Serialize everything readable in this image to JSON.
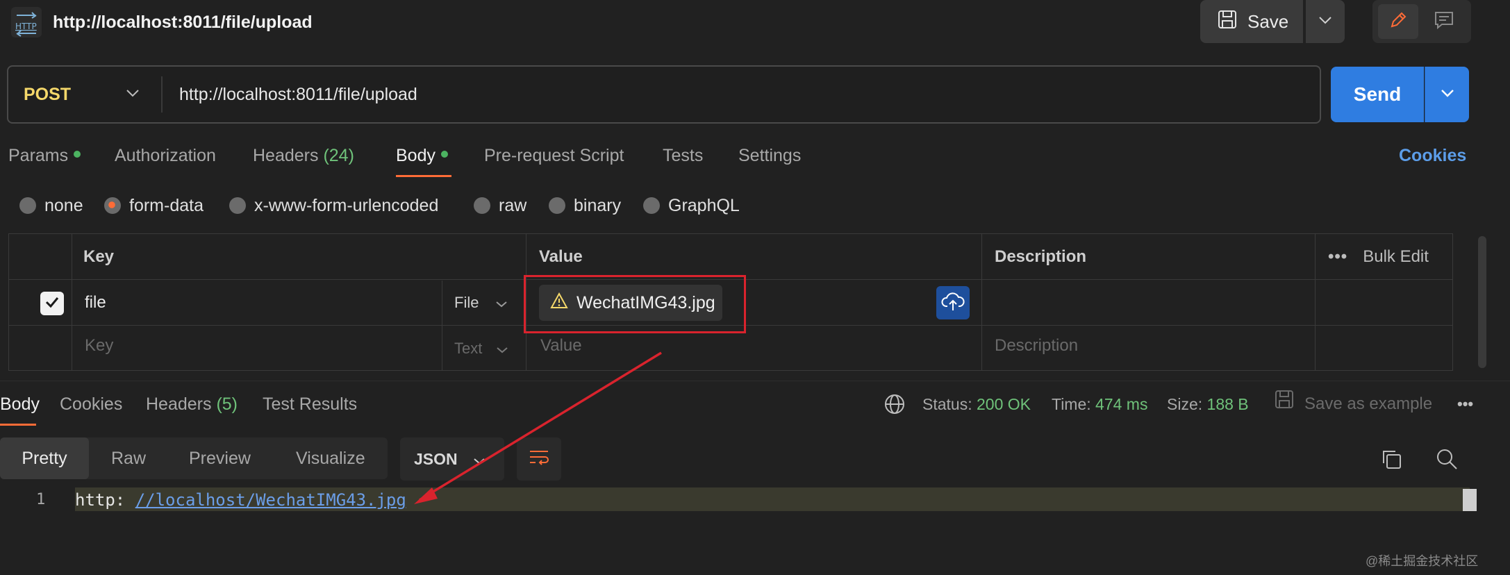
{
  "header": {
    "icon": "http-icon",
    "title": "http://localhost:8011/file/upload",
    "save_label": "Save"
  },
  "request": {
    "method": "POST",
    "url": "http://localhost:8011/file/upload",
    "send_label": "Send"
  },
  "request_tabs": [
    {
      "label": "Params",
      "dot": true
    },
    {
      "label": "Authorization"
    },
    {
      "label": "Headers",
      "count": "(24)"
    },
    {
      "label": "Body",
      "dot": true,
      "active": true
    },
    {
      "label": "Pre-request Script"
    },
    {
      "label": "Tests"
    },
    {
      "label": "Settings"
    }
  ],
  "cookies_link": "Cookies",
  "body_modes": [
    {
      "label": "none"
    },
    {
      "label": "form-data",
      "selected": true
    },
    {
      "label": "x-www-form-urlencoded"
    },
    {
      "label": "raw"
    },
    {
      "label": "binary"
    },
    {
      "label": "GraphQL"
    }
  ],
  "table": {
    "headers": {
      "key": "Key",
      "value": "Value",
      "description": "Description",
      "bulk_edit": "Bulk Edit"
    },
    "rows": [
      {
        "checked": true,
        "key": "file",
        "type": "File",
        "value": "WechatIMG43.jpg",
        "description": ""
      }
    ],
    "new_row": {
      "key": "Key",
      "type": "Text",
      "value": "Value",
      "description": "Description"
    }
  },
  "response_tabs": [
    {
      "label": "Body",
      "active": true
    },
    {
      "label": "Cookies"
    },
    {
      "label": "Headers",
      "count": "(5)"
    },
    {
      "label": "Test Results"
    }
  ],
  "status": {
    "status_label": "Status:",
    "status_value": "200 OK",
    "time_label": "Time:",
    "time_value": "474 ms",
    "size_label": "Size:",
    "size_value": "188 B",
    "save_example": "Save as example"
  },
  "view_modes": [
    "Pretty",
    "Raw",
    "Preview",
    "Visualize"
  ],
  "format": "JSON",
  "response_body": {
    "line_number": "1",
    "prefix": "http: ",
    "link": "//localhost/WechatIMG43.jpg"
  },
  "watermark": "@稀土掘金技术社区",
  "colors": {
    "accent": "#ff6c37",
    "send": "#2f7de1",
    "method": "#f5d86a",
    "success": "#6fc27a",
    "annotation": "#d9232d"
  }
}
